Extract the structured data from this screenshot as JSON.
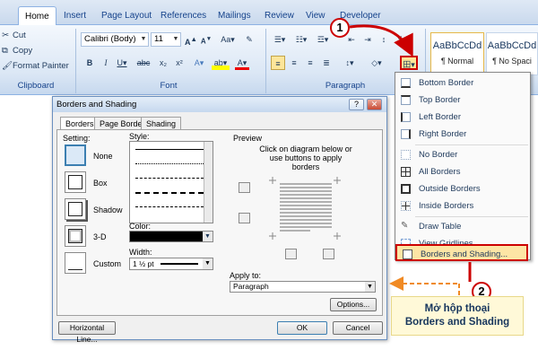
{
  "ribbon": {
    "tabs": [
      "Home",
      "Insert",
      "Page Layout",
      "References",
      "Mailings",
      "Review",
      "View",
      "Developer"
    ],
    "clipboard": {
      "cut": "Cut",
      "copy": "Copy",
      "format_painter": "Format Painter",
      "group": "Clipboard"
    },
    "font": {
      "name": "Calibri (Body)",
      "size": "11",
      "group": "Font"
    },
    "paragraph": {
      "group": "Paragraph"
    },
    "styles": [
      {
        "sample": "AaBbCcDd",
        "name": "¶ Normal"
      },
      {
        "sample": "AaBbCcDd",
        "name": "¶ No Spaci"
      }
    ]
  },
  "borders_menu": {
    "items": [
      {
        "label": "Bottom Border",
        "icon": "border-bottom-icon"
      },
      {
        "label": "Top Border",
        "icon": "border-top-icon"
      },
      {
        "label": "Left Border",
        "icon": "border-left-icon"
      },
      {
        "label": "Right Border",
        "icon": "border-right-icon"
      },
      {
        "label": "No Border",
        "icon": "border-none-icon"
      },
      {
        "label": "All Borders",
        "icon": "border-all-icon"
      },
      {
        "label": "Outside Borders",
        "icon": "border-outside-icon"
      },
      {
        "label": "Inside Borders",
        "icon": "border-inside-icon"
      },
      {
        "label": "Draw Table",
        "icon": "draw-table-icon"
      },
      {
        "label": "View Gridlines",
        "icon": "gridlines-icon"
      },
      {
        "label": "Borders and Shading...",
        "icon": "borders-shading-icon"
      }
    ]
  },
  "dialog": {
    "title": "Borders and Shading",
    "tabs": [
      "Borders",
      "Page Border",
      "Shading"
    ],
    "setting_label": "Setting:",
    "settings": [
      "None",
      "Box",
      "Shadow",
      "3-D",
      "Custom"
    ],
    "style_label": "Style:",
    "color_label": "Color:",
    "width_label": "Width:",
    "width_value": "1 ½ pt",
    "preview_label": "Preview",
    "preview_hint": "Click on diagram below or use buttons to apply borders",
    "apply_to_label": "Apply to:",
    "apply_to_value": "Paragraph",
    "options_button": "Options...",
    "horizontal_line_button": "Horizontal Line...",
    "ok_button": "OK",
    "cancel_button": "Cancel"
  },
  "callouts": {
    "step1": "1",
    "step2": "2",
    "caption_line1": "Mở hộp thoại",
    "caption_line2": "Borders and Shading"
  },
  "colors": {
    "accent": "#c00000",
    "ribbon_blue": "#15428b",
    "highlight": "#fde5a5"
  }
}
